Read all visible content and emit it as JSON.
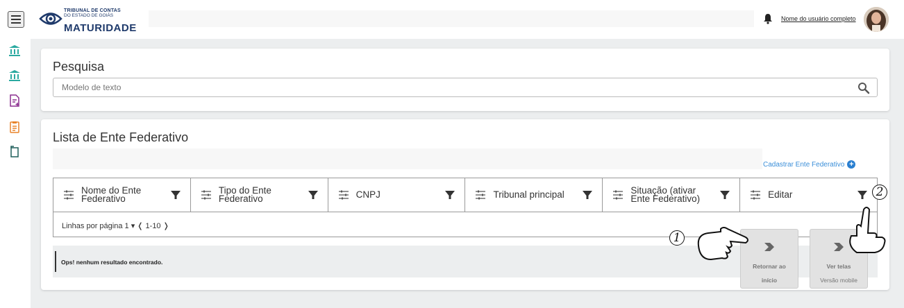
{
  "header": {
    "logo_line1": "TRIBUNAL DE CONTAS",
    "logo_line2": "DO ESTADO DE GOIÁS",
    "logo_line3": "MATURIDADE",
    "username": "Nome do usuário completo"
  },
  "sidebar": {
    "items": [
      {
        "icon": "bank-icon",
        "color": "#2aa9a0"
      },
      {
        "icon": "bank-icon",
        "color": "#2aa9a0"
      },
      {
        "icon": "file-add-icon",
        "color": "#8b2f8f"
      },
      {
        "icon": "clipboard-list-icon",
        "color": "#e8842a"
      },
      {
        "icon": "flag-document-icon",
        "color": "#1f5e5a"
      }
    ]
  },
  "search_card": {
    "title": "Pesquisa",
    "placeholder": "Modelo de texto"
  },
  "list_card": {
    "title": "Lista de Ente Federativo",
    "register_label": "Cadastrar Ente Federativo",
    "columns": [
      {
        "line1": "Nome do Ente",
        "line2": "Federativo"
      },
      {
        "line1": "Tipo do Ente",
        "line2": "Federativo"
      },
      {
        "line1": "CNPJ",
        "line2": ""
      },
      {
        "line1": "Tribunal principal",
        "line2": ""
      },
      {
        "line1": "Situação (ativar",
        "line2": "Ente Federativo)"
      },
      {
        "line1": "Editar",
        "line2": ""
      }
    ],
    "pager": "Linhas por  página  1 ▾ ❬ 1-10 ❭",
    "empty_message": "Ops! nenhum resultado encontrado."
  },
  "tips": {
    "return_label": "Retornar ao",
    "return_label2": "início",
    "mobile_label": "Ver telas",
    "mobile_label2": "Versão mobile",
    "badge1": "1",
    "badge2": "2"
  },
  "colors": {
    "accent": "#3a8ed8",
    "brand": "#1f3a6b",
    "background": "#eceeef"
  }
}
